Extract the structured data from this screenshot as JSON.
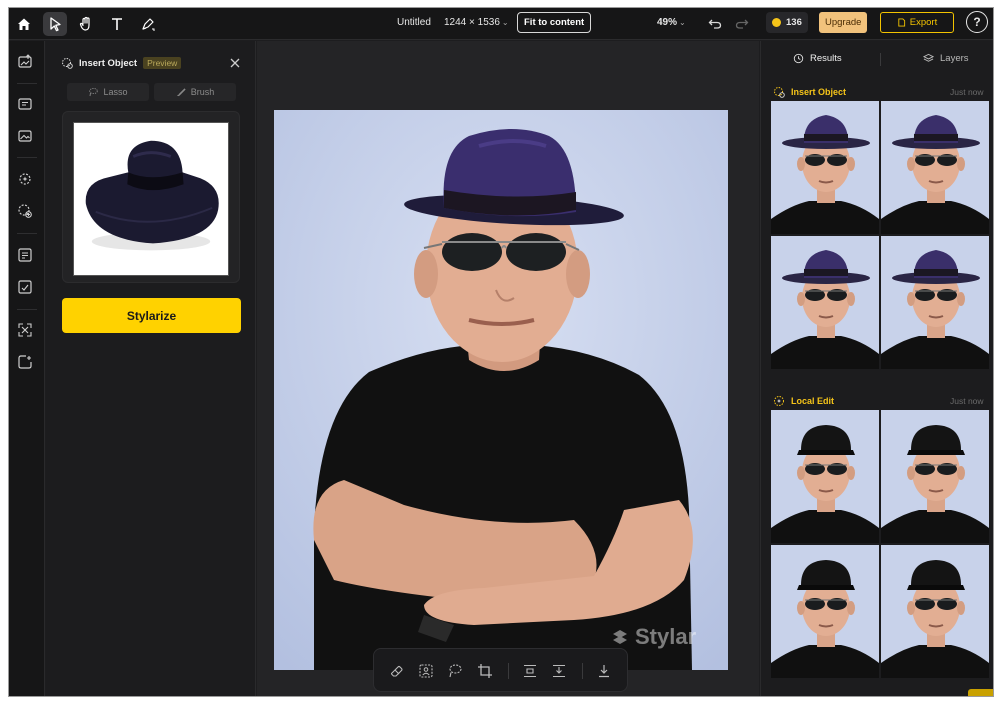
{
  "topbar": {
    "home_icon": "home-icon",
    "tools": [
      "select-arrow-icon",
      "hand-icon",
      "text-icon",
      "pen-icon"
    ],
    "doc_title": "Untitled",
    "doc_size": "1244 × 1536",
    "fit_label": "Fit to content",
    "zoom": "49%",
    "credits": "136",
    "upgrade_label": "Upgrade",
    "export_label": "Export",
    "help_label": "?"
  },
  "rail": {
    "icons": [
      "upload-image-icon",
      "text-edit-icon",
      "image-edit-icon",
      "magic-icon",
      "insert-object-icon",
      "expand-icon",
      "crop-edit-icon",
      "resize-icon",
      "add-frame-icon"
    ]
  },
  "panel": {
    "title": "Insert Object",
    "badge": "Preview",
    "lasso_label": "Lasso",
    "brush_label": "Brush",
    "stylize_label": "Stylarize"
  },
  "canvas": {
    "watermark": "Stylar"
  },
  "results": {
    "tab_results": "Results",
    "tab_layers": "Layers",
    "sections": [
      {
        "title": "Insert Object",
        "time": "Just now"
      },
      {
        "title": "Local Edit",
        "time": "Just now"
      }
    ]
  },
  "colors": {
    "accent": "#ffd200",
    "export": "#f2c300",
    "upgrade_bg": "#f1c27c",
    "background": "#1d1d1f"
  }
}
